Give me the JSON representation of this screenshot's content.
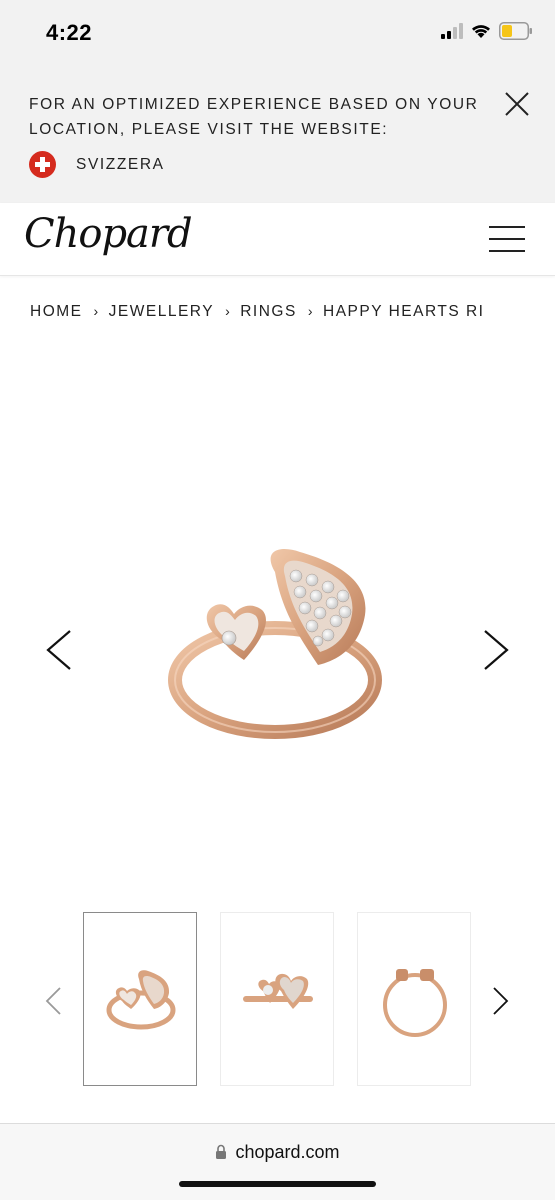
{
  "status_bar": {
    "time": "4:22",
    "icons": [
      "signal-icon",
      "wifi-icon",
      "battery-icon"
    ]
  },
  "location_banner": {
    "message": "FOR AN OPTIMIZED EXPERIENCE BASED ON YOUR LOCATION, PLEASE VISIT THE WEBSITE:",
    "country": "SVIZZERA",
    "close_icon": "close-icon",
    "flag_icon": "swiss-flag-icon"
  },
  "header": {
    "logo": "Chopard",
    "menu_icon": "hamburger-menu-icon"
  },
  "breadcrumb": {
    "items": [
      "HOME",
      "JEWELLERY",
      "RINGS",
      "HAPPY HEARTS RI"
    ],
    "separator": "›"
  },
  "product_gallery": {
    "prev_icon": "chevron-left-icon",
    "next_icon": "chevron-right-icon",
    "image": "rose-gold-happy-hearts-ring"
  },
  "thumbnails": {
    "prev_icon": "chevron-left-icon",
    "next_icon": "chevron-right-icon",
    "items": [
      {
        "image": "ring-angled-view",
        "active": true
      },
      {
        "image": "ring-top-view",
        "active": false
      },
      {
        "image": "ring-front-view",
        "active": false
      }
    ]
  },
  "browser": {
    "url": "chopard.com",
    "lock_icon": "lock-icon"
  },
  "colors": {
    "rose_gold": "#d9a37f",
    "rose_gold_dark": "#b77a58",
    "flag_red": "#d52b1e",
    "banner_bg": "#f2f2f2"
  }
}
